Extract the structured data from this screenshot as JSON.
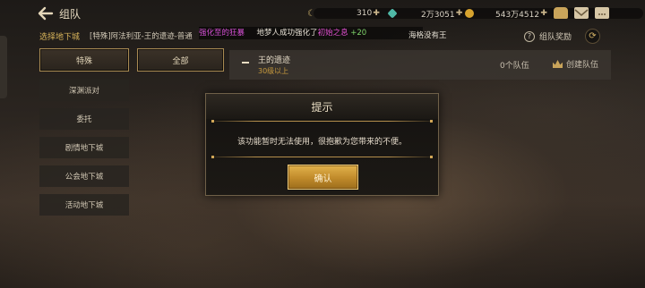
{
  "header": {
    "title": "组队",
    "resources": [
      {
        "value": "310",
        "color": "#c9b06a"
      },
      {
        "value": "2万3051",
        "color": "#4fb8a6"
      },
      {
        "value": "543万4512",
        "color": "#d7a32e"
      }
    ]
  },
  "subheader": {
    "dungeon_label": "选择地下城",
    "marquee": "[特殊]阿法利亚-王的遗迹-普通",
    "announce_prefix": "强化至",
    "announce_mid": "的狂暴",
    "announce_user": "地梦人成功强化了",
    "announce_item": "初始之息",
    "announce_level": "+20",
    "announce_tail": "海格没有王",
    "help_label": "组队奖励"
  },
  "tabs": {
    "special": "特殊",
    "all": "全部"
  },
  "sidebar": {
    "items": [
      "深渊派对",
      "委托",
      "剧情地下城",
      "公会地下城",
      "活动地下城"
    ]
  },
  "team_list": {
    "dungeon_name": "王的遗迹",
    "level_req": "30级以上",
    "team_count": "0个队伍",
    "create_label": "创建队伍"
  },
  "dialog": {
    "title": "提示",
    "message": "该功能暂时无法使用，很抱歉为您带来的不便。",
    "confirm_label": "确认"
  },
  "colors": {
    "accent_gold": "#c79a3e",
    "announce_pink": "#d44fd4",
    "announce_green": "#7fd36a"
  }
}
